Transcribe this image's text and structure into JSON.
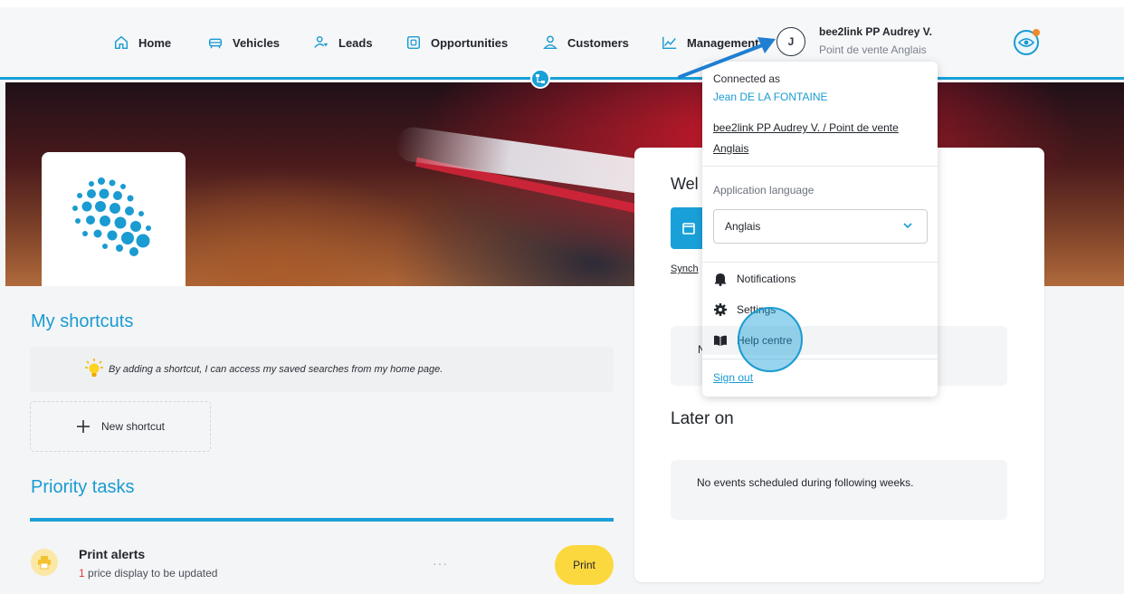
{
  "nav": {
    "items": [
      {
        "label": "Home",
        "icon": "home-icon"
      },
      {
        "label": "Vehicles",
        "icon": "car-icon"
      },
      {
        "label": "Leads",
        "icon": "leads-icon"
      },
      {
        "label": "Opportunities",
        "icon": "wallet-icon"
      },
      {
        "label": "Customers",
        "icon": "person-icon"
      },
      {
        "label": "Management",
        "icon": "chart-line-icon"
      }
    ],
    "user_initial": "J",
    "user_name": "bee2link PP Audrey V.",
    "user_store": "Point de vente Anglais"
  },
  "shortcuts": {
    "title": "My shortcuts",
    "tip": "By adding a shortcut, I can access my saved searches from my home page.",
    "new_label": "New shortcut"
  },
  "priority": {
    "title": "Priority tasks",
    "alert_title": "Print alerts",
    "alert_count": "1",
    "alert_text": " price display to be updated",
    "dots": "···",
    "print_label": "Print"
  },
  "right_card": {
    "welcome_partial": "Wel",
    "sync_partial": "Synch",
    "today_partial": "N",
    "later_title": "Later on",
    "later_text": "No events scheduled during following weeks."
  },
  "menu": {
    "connected_as": "Connected as",
    "user_full": "Jean DE LA FONTAINE",
    "store_full": "bee2link PP Audrey V. / Point de vente Anglais",
    "lang_label": "Application language",
    "lang_value": "Anglais",
    "notifications": "Notifications",
    "settings": "Settings",
    "help": "Help centre",
    "signout": "Sign out"
  },
  "colors": {
    "accent": "#1aa0d8",
    "print_button": "#fcd83f",
    "alert_number": "#e2373c"
  }
}
